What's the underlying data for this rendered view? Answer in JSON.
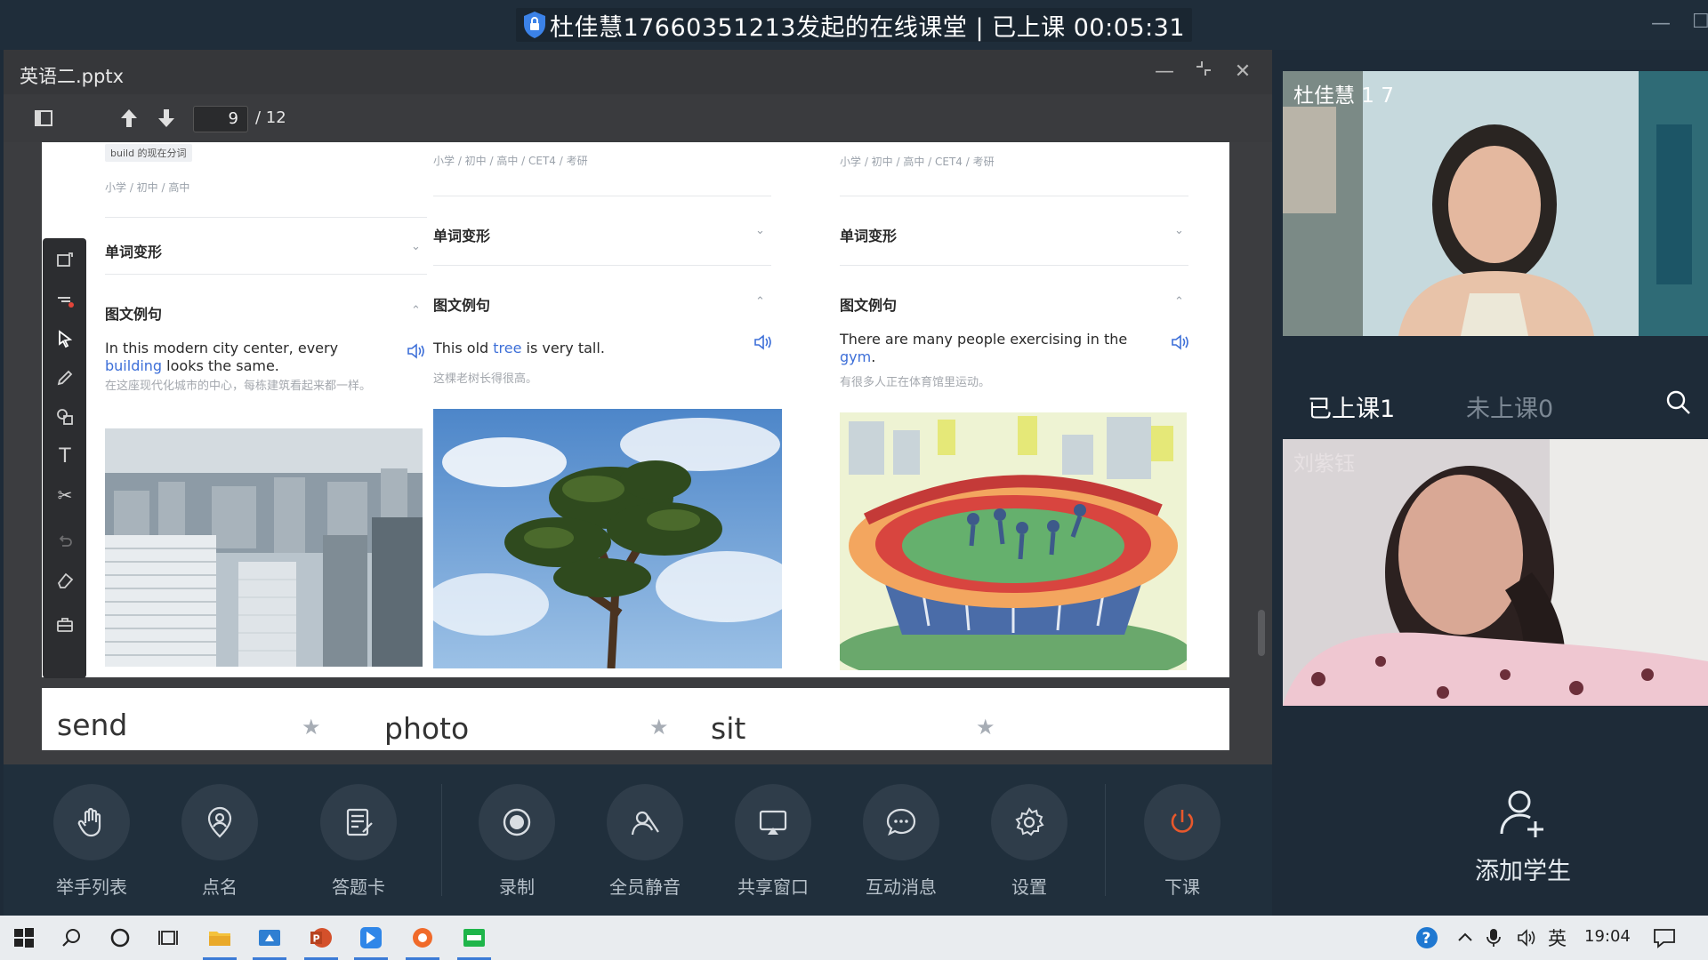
{
  "window": {
    "title": "杜佳慧17660351213发起的在线课堂 | 已上课 00:05:31"
  },
  "viewer": {
    "file_name": "英语二.pptx",
    "page_current": "9",
    "page_total": "/ 12"
  },
  "slide": {
    "cards": [
      {
        "note": "build 的现在分词",
        "levels": "小学 / 初中 / 高中",
        "section_forms": "单词变形",
        "section_examples": "图文例句",
        "sentence_before": "In this modern city center, every ",
        "keyword": "building",
        "sentence_after": " looks the same.",
        "translation": "在这座现代化城市的中心，每栋建筑看起来都一样。",
        "image": "city-skyline"
      },
      {
        "levels": "小学 / 初中 / 高中 / CET4 / 考研",
        "section_forms": "单词变形",
        "section_examples": "图文例句",
        "sentence_before": "This old ",
        "keyword": "tree",
        "sentence_after": " is very tall.",
        "translation": "这棵老树长得很高。",
        "image": "pine-tree"
      },
      {
        "levels": "小学 / 初中 / 高中 / CET4 / 考研",
        "section_forms": "单词变形",
        "section_examples": "图文例句",
        "sentence_before": "There are many people exercising in the ",
        "keyword": "gym",
        "sentence_after": ".",
        "translation": "有很多人正在体育馆里运动。",
        "image": "stadium-illustration"
      }
    ],
    "next_words": [
      "send",
      "photo",
      "sit"
    ]
  },
  "toolbar": {
    "items": [
      {
        "label": "举手列表",
        "icon": "raise-hand-icon"
      },
      {
        "label": "点名",
        "icon": "location-pin-icon"
      },
      {
        "label": "答题卡",
        "icon": "answer-card-icon"
      },
      {
        "label": "录制",
        "icon": "record-icon"
      },
      {
        "label": "全员静音",
        "icon": "mute-all-icon"
      },
      {
        "label": "共享窗口",
        "icon": "share-window-icon"
      },
      {
        "label": "互动消息",
        "icon": "chat-bubble-icon"
      },
      {
        "label": "设置",
        "icon": "gear-icon"
      },
      {
        "label": "下课",
        "icon": "power-icon"
      }
    ]
  },
  "right_panel": {
    "teacher_name": "杜佳慧 1 7",
    "tab_attended": "已上课1",
    "tab_absent": "未上课0",
    "student_name": "刘紫钰",
    "add_student": "添加学生"
  },
  "taskbar": {
    "lang": "英",
    "time": "19:04"
  },
  "colors": {
    "accent_blue": "#3d6fd8",
    "end_class_orange": "#e8582c",
    "panel_dark": "#1e2b38"
  }
}
